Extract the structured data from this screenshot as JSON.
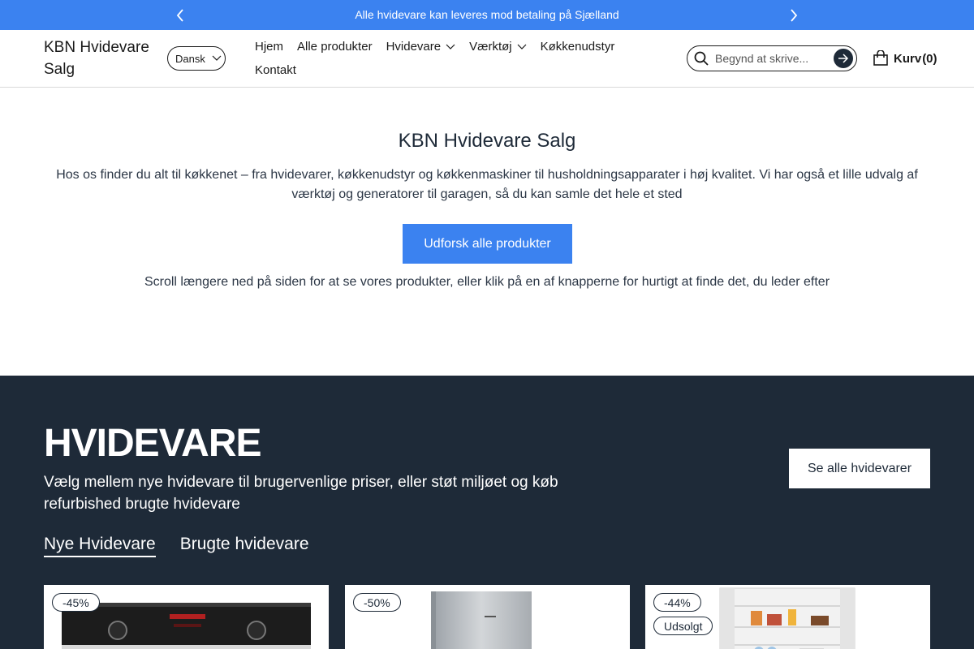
{
  "announcement": {
    "text": "Alle hvidevare kan leveres mod betaling på Sjælland"
  },
  "header": {
    "logo": "KBN Hvidevare Salg",
    "language": "Dansk",
    "nav": [
      {
        "label": "Hjem"
      },
      {
        "label": "Alle produkter"
      },
      {
        "label": "Hvidevare"
      },
      {
        "label": "Værktøj"
      },
      {
        "label": "Køkkenudstyr"
      },
      {
        "label": "Kontakt"
      }
    ],
    "search_placeholder": "Begynd at skrive...",
    "cart_label": "Kurv",
    "cart_count": "(0)"
  },
  "hero": {
    "title": "KBN Hvidevare Salg",
    "description": "Hos os finder du alt til køkkenet – fra hvidevarer, køkkenudstyr og køkkenmaskiner til husholdningsapparater i høj kvalitet. Vi har også et lille udvalg af værktøj og generatorer til garagen, så du kan samle det hele et sted",
    "button": "Udforsk alle produkter",
    "note": "Scroll længere ned på siden for at se vores produkter, eller klik på en af knapperne for hurtigt at finde det, du leder efter"
  },
  "section": {
    "title": "HVIDEVARE",
    "subtitle": "Vælg mellem nye hvidevare til brugervenlige priser, eller støt miljøet og køb refurbished brugte hvidevare",
    "see_all": "Se alle hvidevarer",
    "tabs": [
      {
        "label": "Nye Hvidevare"
      },
      {
        "label": "Brugte hvidevare"
      }
    ],
    "products": [
      {
        "discount": "-45%",
        "image": "built-in-oven"
      },
      {
        "discount": "-50%",
        "image": "stainless-refrigerator"
      },
      {
        "discount": "-44%",
        "sold_out": "Udsolgt",
        "image": "open-fridge-with-food"
      }
    ]
  },
  "colors": {
    "accent": "#3b82f0",
    "dark_section": "#1e2a38"
  }
}
